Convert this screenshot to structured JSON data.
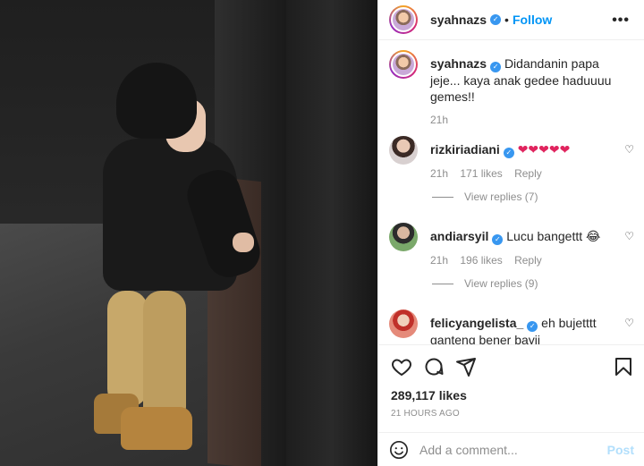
{
  "post": {
    "author": "syahnazs",
    "follow_label": "Follow",
    "separator": "•",
    "more_label": "•••",
    "caption": "Didandanin papa jeje... kaya anak gedee haduuuu gemes!!",
    "caption_time": "21h",
    "likes": "289,117 likes",
    "time_ago": "21 HOURS AGO"
  },
  "comments": [
    {
      "user": "rizkiriadiani",
      "text": "❤❤❤❤❤",
      "time": "21h",
      "likes": "171 likes",
      "reply_label": "Reply",
      "view_replies": "View replies (7)"
    },
    {
      "user": "andiarsyil",
      "text": "Lucu bangettt 😂",
      "time": "21h",
      "likes": "196 likes",
      "reply_label": "Reply",
      "view_replies": "View replies (9)"
    },
    {
      "user": "felicyangelista_",
      "text": "eh bujetttt ganteng bener bayii"
    }
  ],
  "add_comment": {
    "placeholder": "Add a comment...",
    "post_label": "Post"
  },
  "colors": {
    "accent": "#0095f6",
    "verified": "#3897f0",
    "muted": "#8e8e8e",
    "post_disabled": "#b2dffc"
  },
  "icons": [
    "heart-icon",
    "comment-icon",
    "share-icon",
    "bookmark-icon",
    "emoji-icon",
    "more-icon",
    "verified-icon"
  ]
}
